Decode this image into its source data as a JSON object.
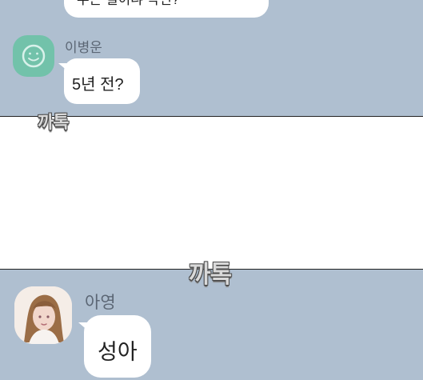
{
  "chat": {
    "message_1": {
      "text": "무슨 일이냐 작년?"
    },
    "message_2": {
      "sender": "이병운",
      "text": "5년 전?"
    },
    "message_3": {
      "sender": "아영",
      "text": "성아"
    }
  },
  "sound_effects": {
    "sfx_1": "까톡",
    "sfx_2": "까톡"
  },
  "colors": {
    "chat_background": "#afbfd0",
    "bubble": "#ffffff",
    "avatar_green": "#72c2aa",
    "sender_name": "#5c6775"
  }
}
